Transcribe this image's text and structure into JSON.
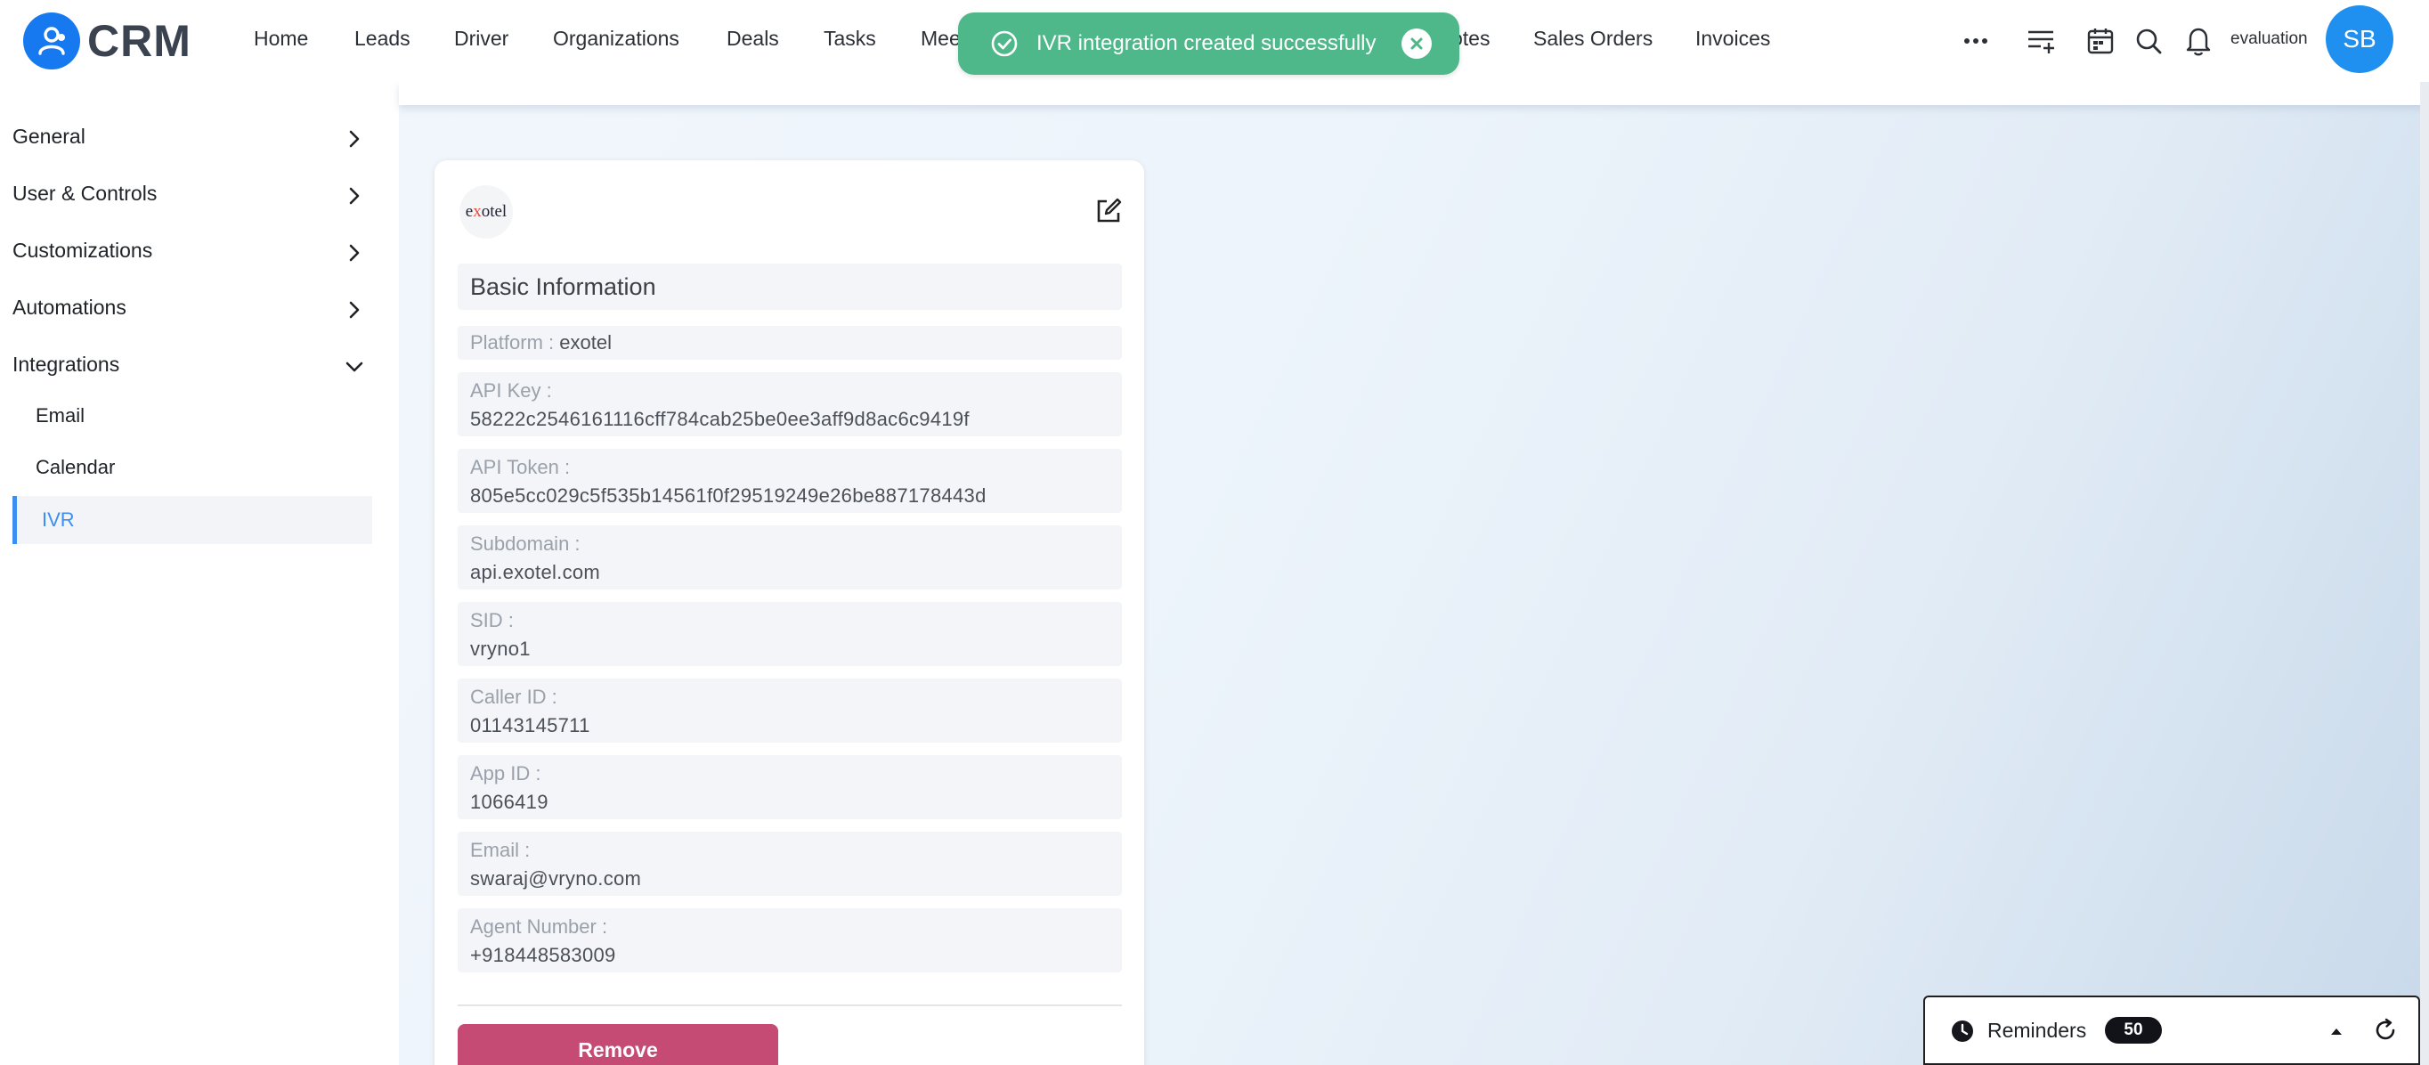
{
  "app": {
    "logo_text": "CRM"
  },
  "nav": {
    "items": [
      "Home",
      "Leads",
      "Driver",
      "Organizations",
      "Deals",
      "Tasks",
      "Mee",
      "otes",
      "Sales Orders",
      "Invoices"
    ],
    "user_label": "evaluation",
    "avatar_initials": "SB"
  },
  "toast": {
    "message": "IVR integration created successfully",
    "color": "#4fb88a"
  },
  "sidebar": {
    "sections": [
      {
        "label": "General",
        "expanded": false
      },
      {
        "label": "User & Controls",
        "expanded": false
      },
      {
        "label": "Customizations",
        "expanded": false
      },
      {
        "label": "Automations",
        "expanded": false
      },
      {
        "label": "Integrations",
        "expanded": true
      }
    ],
    "sub_items": [
      "Email",
      "Calendar",
      "IVR"
    ],
    "active_item": "IVR",
    "accent_color": "#3b8ff0"
  },
  "card": {
    "logo_text_pre": "e",
    "logo_text_accent": "x",
    "logo_text_post": "otel",
    "section_title": "Basic Information",
    "platform": {
      "label": "Platform : ",
      "value": "exotel"
    },
    "fields": [
      {
        "label": "API Key :",
        "value": "58222c2546161116cff784cab25be0ee3aff9d8ac6c9419f"
      },
      {
        "label": "API Token :",
        "value": "805e5cc029c5f535b14561f0f29519249e26be887178443d"
      },
      {
        "label": "Subdomain :",
        "value": "api.exotel.com"
      },
      {
        "label": "SID :",
        "value": "vryno1"
      },
      {
        "label": "Caller ID :",
        "value": "01143145711"
      },
      {
        "label": "App ID :",
        "value": "1066419"
      },
      {
        "label": "Email :",
        "value": "swaraj@vryno.com"
      },
      {
        "label": "Agent Number :",
        "value": "+918448583009"
      }
    ],
    "remove_label": "Remove",
    "remove_color": "#c54b74"
  },
  "reminders": {
    "label": "Reminders",
    "count": "50"
  }
}
